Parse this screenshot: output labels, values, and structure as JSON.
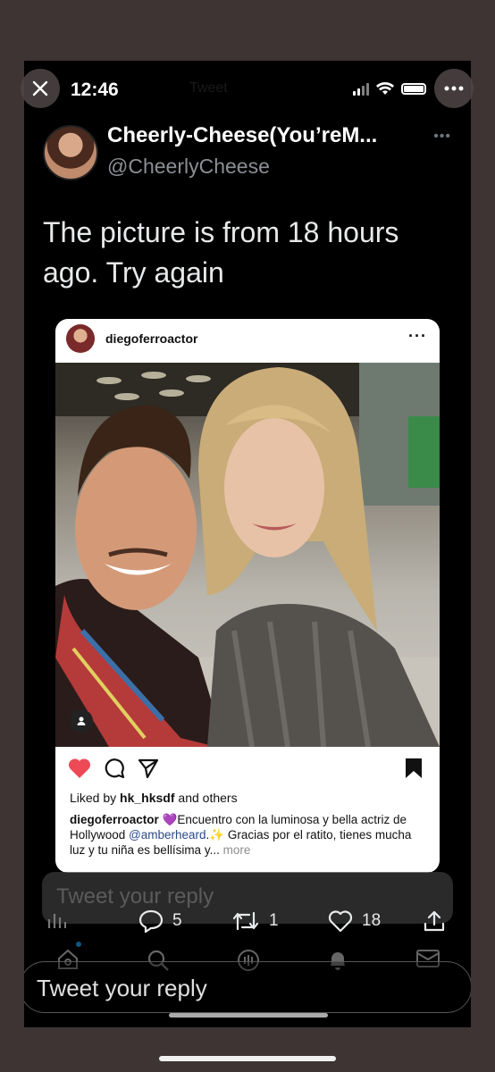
{
  "status_bar": {
    "time": "12:46"
  },
  "ghost_header_text": "Tweet",
  "tweet": {
    "author_name": "Cheerly-Cheese(You’reM...",
    "author_handle": "@CheerlyCheese",
    "text": "The picture is from 18 hours ago. Try again"
  },
  "instagram": {
    "username": "diegoferroactor",
    "liked_by_prefix": "Liked by ",
    "liked_by_user": "hk_hksdf",
    "liked_by_suffix": " and others",
    "caption_user": "diegoferroactor",
    "caption_part1": " 💜Encuentro con la luminosa y bella actriz de Hollywood ",
    "caption_mention": "@amberheard",
    "caption_part2": ".✨ Gracias por el ratito, tienes mucha luz y tu niña es bellísima y...",
    "more_label": " more"
  },
  "reply_ghost_placeholder": "Tweet your reply",
  "actions": {
    "replies": "5",
    "retweets": "1",
    "likes": "18"
  },
  "reply_placeholder": "Tweet your reply",
  "icons": {
    "close": "close-icon",
    "more": "more-icon",
    "analytics": "analytics-icon",
    "reply": "reply-icon",
    "retweet": "retweet-icon",
    "like": "heart-icon",
    "share": "share-icon",
    "home": "home-icon",
    "search": "search-icon",
    "spaces": "spaces-icon",
    "notifications": "bell-icon",
    "messages": "mail-icon"
  },
  "colors": {
    "like_red": "#ed4956",
    "accent_blue": "#1d9bf0",
    "background": "#000000"
  }
}
